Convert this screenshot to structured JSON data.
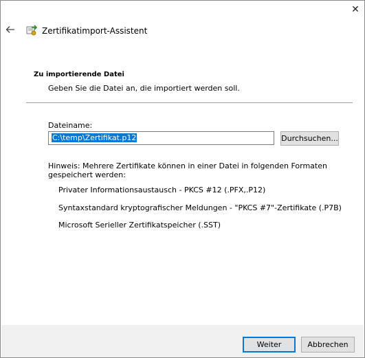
{
  "window": {
    "close_glyph": "✕",
    "title": "Zertifikatimport-Assistent"
  },
  "section": {
    "heading": "Zu importierende Datei",
    "description": "Geben Sie die Datei an, die importiert werden soll."
  },
  "file": {
    "label": "Dateiname:",
    "value": "C:\\temp\\Zertifikat.p12",
    "browse_label": "Durchsuchen..."
  },
  "hint": {
    "text": "Hinweis: Mehrere Zertifikate können in einer Datei in folgenden Formaten gespeichert werden:",
    "formats": [
      "Privater Informationsaustausch - PKCS #12 (.PFX,.P12)",
      "Syntaxstandard kryptografischer Meldungen - \"PKCS #7\"-Zertifikate (.P7B)",
      "Microsoft Serieller Zertifikatspeicher (.SST)"
    ]
  },
  "buttons": {
    "next": "Weiter",
    "cancel": "Abbrechen"
  },
  "colors": {
    "selection": "#0078d7",
    "footer": "#f0f0f0"
  },
  "icons": {
    "back": "arrow-left-icon",
    "wizard": "certificate-icon",
    "close": "close-icon"
  }
}
